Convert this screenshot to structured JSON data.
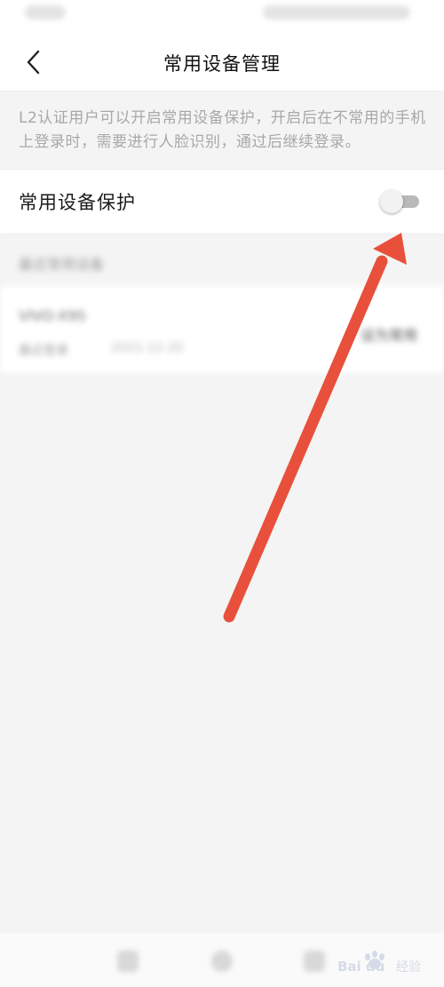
{
  "page": {
    "title": "常用设备管理",
    "description": "L2认证用户可以开启常用设备保护，开启后在不常用的手机上登录时，需要进行人脸识别，通过后继续登录。"
  },
  "protection": {
    "label": "常用设备保护",
    "enabled": false
  },
  "recent_devices": {
    "header": "最近常用设备",
    "items": [
      {
        "name": "VIVO-X9S",
        "meta_label": "最近登录",
        "meta_time": "2021-12-20",
        "action": "设为常用"
      }
    ]
  },
  "icons": {
    "back": "chevron-left-icon",
    "annotation": "red-arrow"
  },
  "colors": {
    "annotation_arrow": "#e8503c",
    "toggle_track_off": "#b9b9b9",
    "description_text": "#a8a8a8"
  },
  "watermark": {
    "brand": "Bai du",
    "suffix": "经验"
  }
}
